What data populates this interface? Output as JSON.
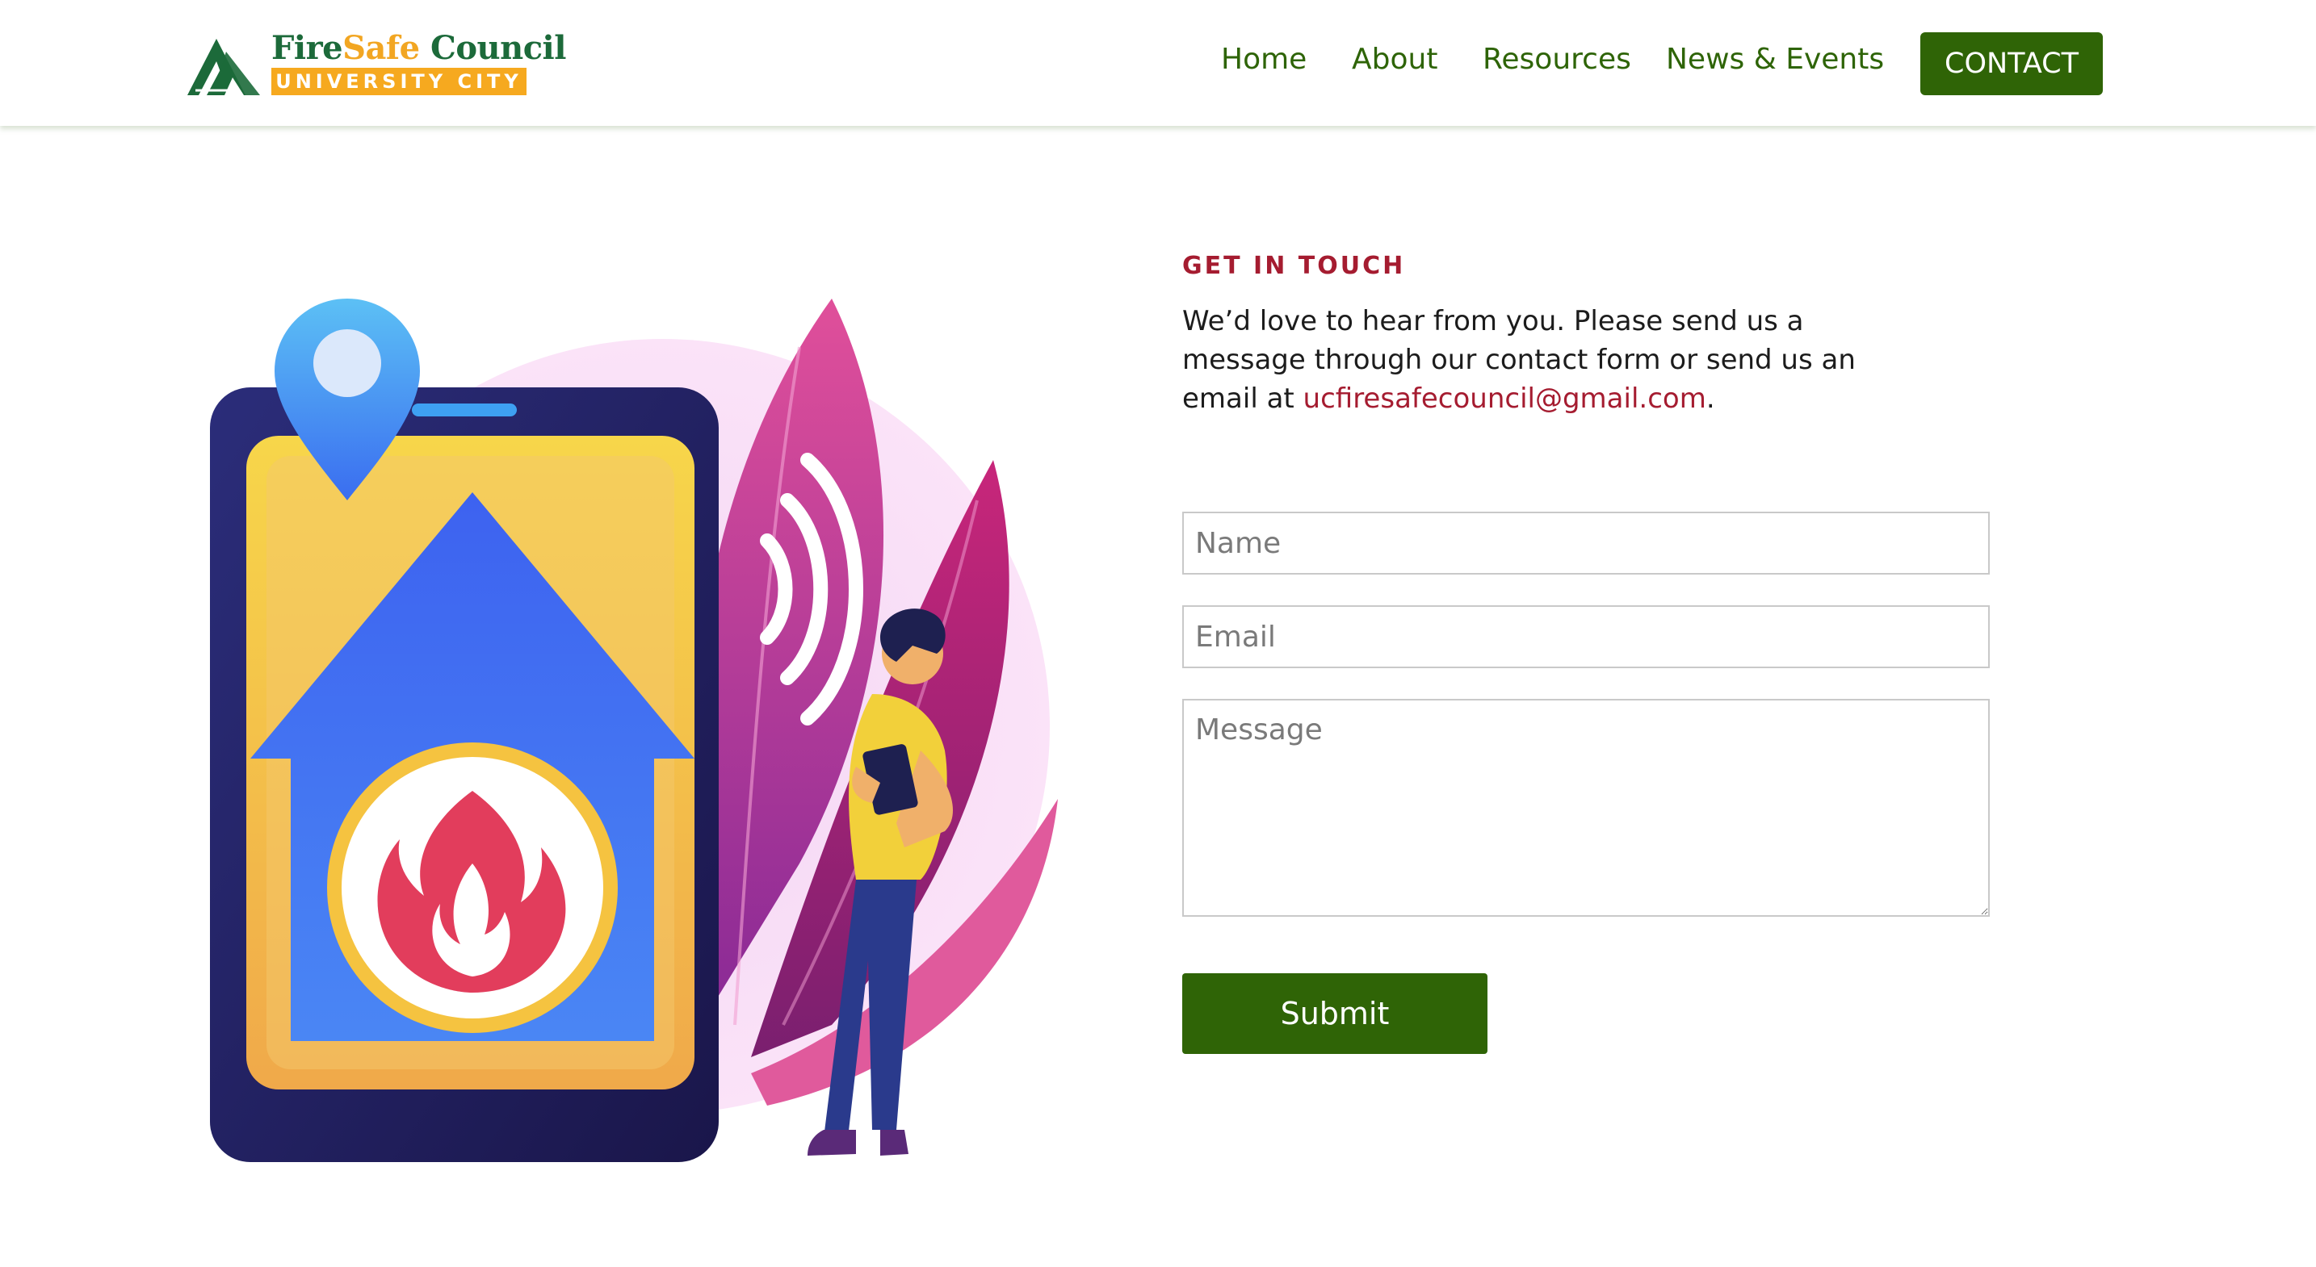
{
  "header": {
    "logo": {
      "title_part1": "Fire",
      "title_part2": "Safe",
      "title_part3": " Council",
      "subtitle": "UNIVERSITY CITY",
      "icon": "pine-tree-icon"
    },
    "nav": {
      "items": [
        "Home",
        "About",
        "Resources",
        "News & Events"
      ],
      "contact_label": "CONTACT"
    }
  },
  "contact": {
    "kicker": "GET IN TOUCH",
    "intro_text": "We’d love to hear from you. Please send us a message through our contact form or send us an email at ",
    "email": "ucfiresafecouncil@gmail.com",
    "intro_end": ".",
    "form": {
      "name_placeholder": "Name",
      "email_placeholder": "Email",
      "message_placeholder": "Message",
      "submit_label": "Submit"
    }
  },
  "colors": {
    "brand_green": "#2f6406",
    "nav_green": "#2e6407",
    "accent_red": "#a51c30",
    "logo_orange": "#f6a91f",
    "logo_dark_green": "#1c6a3a"
  }
}
